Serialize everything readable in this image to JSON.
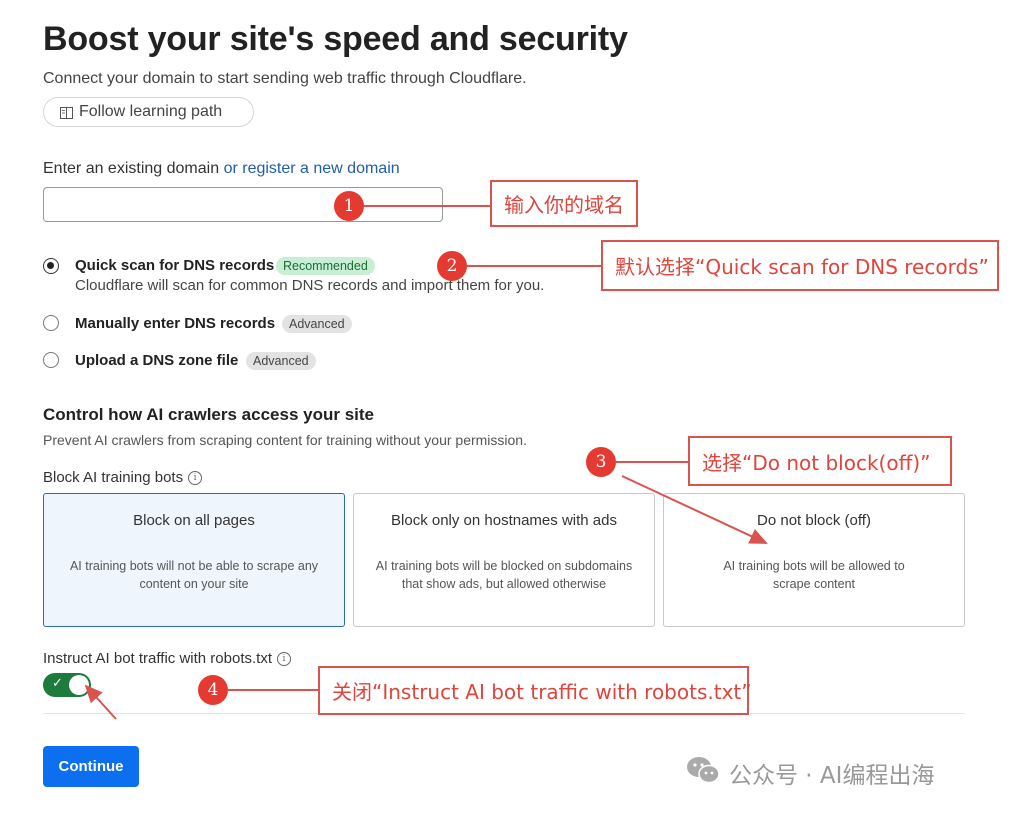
{
  "header": {
    "title": "Boost your site's speed and security",
    "subtitle": "Connect your domain to start sending web traffic through Cloudflare.",
    "learning_path_label": "Follow learning path"
  },
  "domain": {
    "label_prefix": "Enter an existing domain",
    "register_link": "or register a new domain",
    "value": ""
  },
  "dns_options": [
    {
      "label": "Quick scan for DNS records",
      "badge": "Recommended",
      "description": "Cloudflare will scan for common DNS records and import them for you.",
      "checked": true
    },
    {
      "label": "Manually enter DNS records",
      "badge": "Advanced",
      "checked": false
    },
    {
      "label": "Upload a DNS zone file",
      "badge": "Advanced",
      "checked": false
    }
  ],
  "ai_section": {
    "title": "Control how AI crawlers access your site",
    "description": "Prevent AI crawlers from scraping content for training without your permission.",
    "block_label": "Block AI training bots",
    "cards": [
      {
        "title": "Block on all pages",
        "description": "AI training bots will not be able to scrape any content on your site",
        "selected": true
      },
      {
        "title": "Block only on hostnames with ads",
        "description": "AI training bots will be blocked on subdomains that show ads, but allowed otherwise",
        "selected": false
      },
      {
        "title": "Do not block (off)",
        "description": "AI training bots will be allowed to scrape content",
        "selected": false
      }
    ],
    "robots_label": "Instruct AI bot traffic with robots.txt",
    "robots_enabled": true
  },
  "continue_label": "Continue",
  "annotations": [
    {
      "number": "1",
      "text": "输入你的域名"
    },
    {
      "number": "2",
      "text": "默认选择“Quick scan for DNS records”"
    },
    {
      "number": "3",
      "text": "选择“Do not block(off)”"
    },
    {
      "number": "4",
      "text": "关闭“Instruct AI bot traffic with robots.txt”"
    }
  ],
  "watermark": {
    "text": "公众号 · AI编程出海",
    "icon": "wechat-icon"
  },
  "colors": {
    "accent": "#0b6ff0",
    "annotation_red": "#e53a32",
    "toggle_on": "#1e7b3c",
    "selected_card_border": "#2b6cb8"
  }
}
